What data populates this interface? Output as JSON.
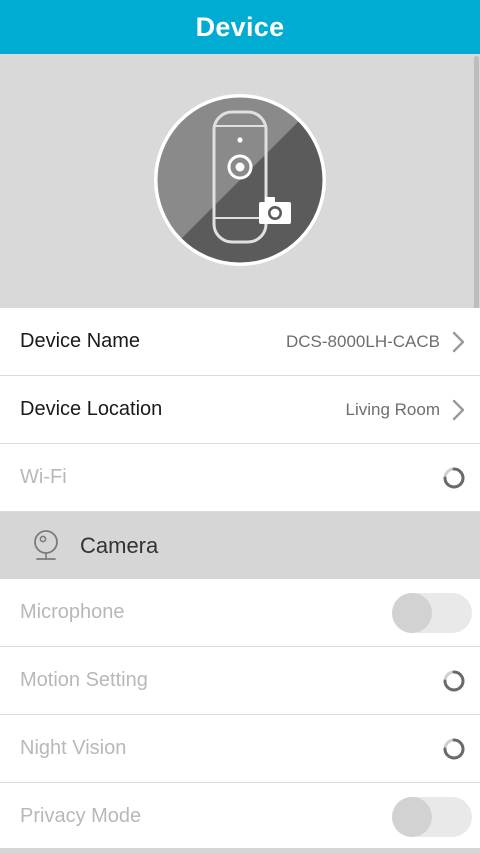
{
  "header": {
    "title": "Device"
  },
  "rows": {
    "device_name": {
      "label": "Device Name",
      "value": "DCS-8000LH-CACB"
    },
    "device_location": {
      "label": "Device Location",
      "value": "Living Room"
    },
    "wifi": {
      "label": "Wi-Fi"
    }
  },
  "camera_section": {
    "title": "Camera",
    "items": {
      "microphone": {
        "label": "Microphone",
        "toggle_on": false
      },
      "motion_setting": {
        "label": "Motion Setting"
      },
      "night_vision": {
        "label": "Night Vision"
      },
      "privacy_mode": {
        "label": "Privacy Mode",
        "toggle_on": false
      }
    }
  },
  "icons": {
    "avatar": "camera-device-icon",
    "photo": "camera-photo-icon",
    "chevron": "chevron-right-icon",
    "spinner": "loading-spinner-icon",
    "section": "webcam-icon"
  },
  "colors": {
    "header_bg": "#00acd1",
    "hero_bg": "#d9d9d9",
    "section_bg": "#d6d6d6",
    "disabled_text": "#b8b8b8"
  }
}
